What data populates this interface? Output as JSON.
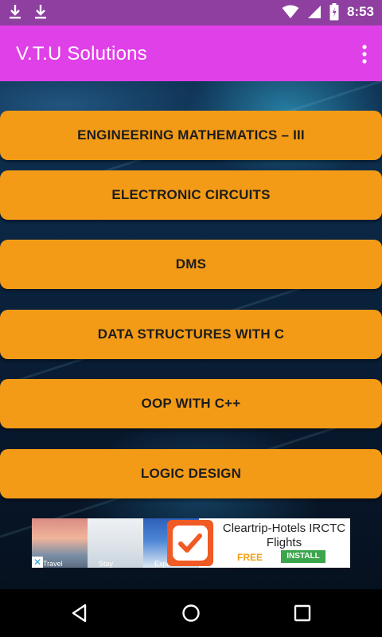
{
  "status_bar": {
    "time": "8:53",
    "left_icons": [
      "download-icon",
      "download-icon"
    ],
    "right_icons": [
      "wifi-icon",
      "signal-icon",
      "battery-icon"
    ]
  },
  "app_bar": {
    "title": "V.T.U Solutions",
    "overflow_icon": "more-vert-icon"
  },
  "menu": {
    "items": [
      {
        "label": "ENGINEERING MATHEMATICS – III"
      },
      {
        "label": "ELECTRONIC CIRCUITS"
      },
      {
        "label": "DMS"
      },
      {
        "label": "DATA STRUCTURES WITH C"
      },
      {
        "label": "OOP WITH C++"
      },
      {
        "label": "LOGIC DESIGN"
      }
    ]
  },
  "ad": {
    "photo_labels": [
      "Travel",
      "Stay",
      "Experience"
    ],
    "title": "Cleartrip-Hotels IRCTC Flights",
    "price": "FREE",
    "cta": "INSTALL",
    "close_icon": "close-icon"
  },
  "nav_bar": {
    "buttons": [
      "back-icon",
      "home-icon",
      "recents-icon"
    ]
  },
  "colors": {
    "status_bar": "#8e3fa0",
    "app_bar": "#e040e8",
    "menu_button": "#f39b17",
    "install": "#3aa54a"
  }
}
